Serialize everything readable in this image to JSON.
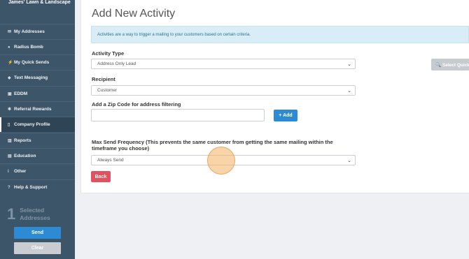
{
  "sidebar": {
    "brand": "James' Lawn & Landscape",
    "items": [
      {
        "label": "My Addresses",
        "icon": "envelope-icon",
        "glyph": "✉"
      },
      {
        "label": "Radius Bomb",
        "icon": "bomb-icon",
        "glyph": "●"
      },
      {
        "label": "My Quick Sends",
        "icon": "bolt-icon",
        "glyph": "⚡"
      },
      {
        "label": "Text Messaging",
        "icon": "chat-icon",
        "glyph": "◆"
      },
      {
        "label": "EDDM",
        "icon": "image-icon",
        "glyph": "▣"
      },
      {
        "label": "Referral Rewards",
        "icon": "gift-icon",
        "glyph": "✱"
      },
      {
        "label": "Company Profile",
        "icon": "file-icon",
        "glyph": "▯",
        "active": true
      },
      {
        "label": "Reports",
        "icon": "chart-icon",
        "glyph": "▥"
      },
      {
        "label": "Education",
        "icon": "bank-icon",
        "glyph": "▤"
      },
      {
        "label": "Other",
        "icon": "info-icon",
        "glyph": "i"
      },
      {
        "label": "Help & Support",
        "icon": "question-icon",
        "glyph": "?"
      }
    ],
    "selected_count": "1",
    "selected_label": "Selected Addresses",
    "send_label": "Send",
    "clear_label": "Clear"
  },
  "main": {
    "title": "Add New Activity",
    "info": "Activities are a way to trigger a mailing to your customers based on certain criteria.",
    "activity_type_label": "Activity Type",
    "activity_type_value": "Address Only Lead",
    "recipient_label": "Recipient",
    "recipient_value": "Customer",
    "zip_label": "Add a Zip Code for address filtering",
    "zip_value": "",
    "add_label": "+ Add",
    "frequency_label": "Max Send Frequency (This prevents the same customer from getting the same mailing within the timeframe you choose)",
    "frequency_value": "Always Send",
    "back_label": "Back",
    "quick_select_label": "🔍 Select Quick"
  },
  "colors": {
    "sidebar": "#3d5568",
    "primary": "#2d8bd6",
    "danger": "#e05260",
    "info_bg": "#d9edf7"
  }
}
